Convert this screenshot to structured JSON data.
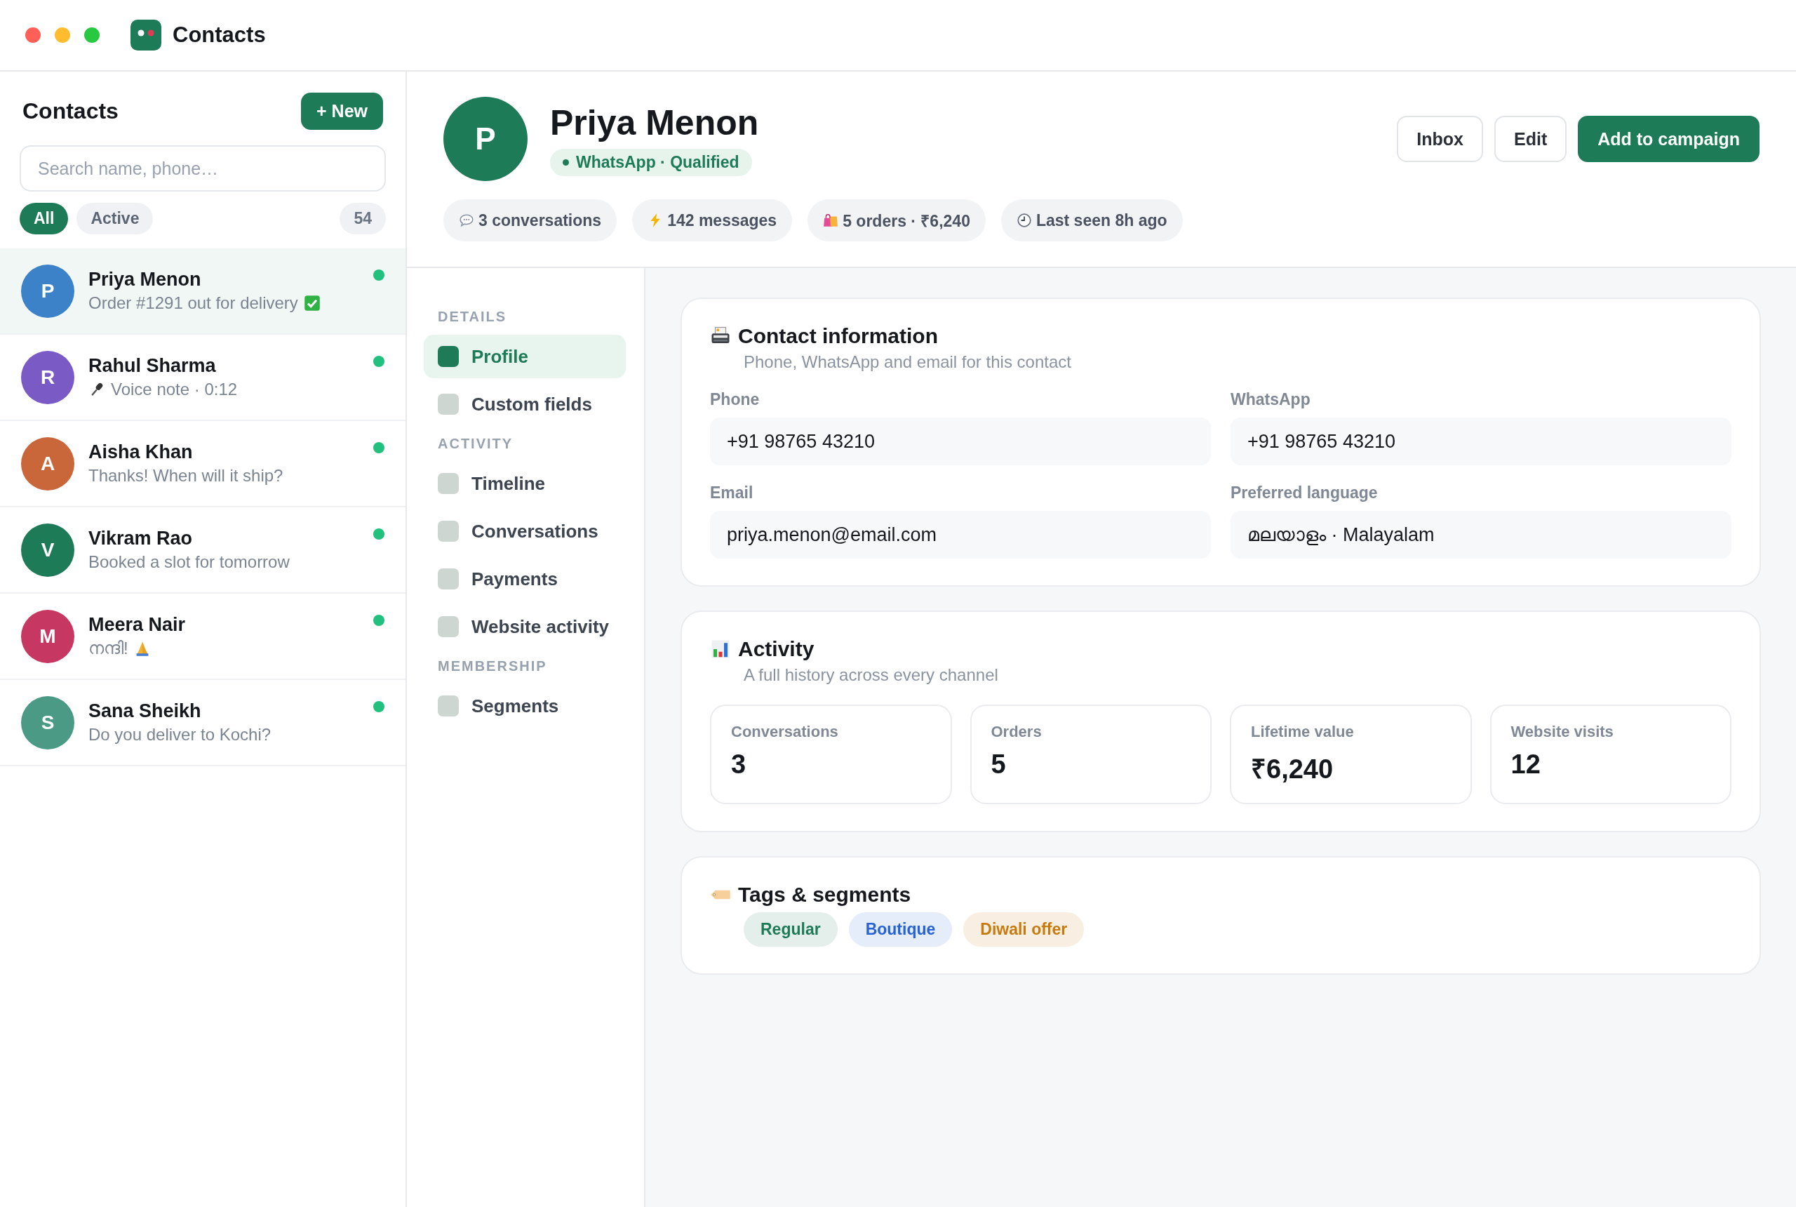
{
  "window": {
    "title": "Contacts"
  },
  "sidebar": {
    "title": "Contacts",
    "new_button": "+ New",
    "search": {
      "placeholder": "Search name, phone…"
    },
    "filters": [
      {
        "label": "All",
        "selected": true
      },
      {
        "label": "Active",
        "selected": false
      }
    ],
    "count": "54",
    "contacts": [
      {
        "initial": "P",
        "name": "Priya Menon",
        "preview": "Order #1291 out for delivery",
        "kind": "check",
        "color": "#3b82c8",
        "online": true,
        "selected": true
      },
      {
        "initial": "R",
        "name": "Rahul Sharma",
        "preview": "Voice note · 0:12",
        "kind": "mic",
        "color": "#7a5bc6",
        "online": true,
        "selected": false
      },
      {
        "initial": "A",
        "name": "Aisha Khan",
        "preview": "Thanks! When will it ship?",
        "color": "#c9673a",
        "online": true,
        "selected": false
      },
      {
        "initial": "V",
        "name": "Vikram Rao",
        "preview": "Booked a slot for tomorrow",
        "color": "#1e7b57",
        "online": true,
        "selected": false
      },
      {
        "initial": "M",
        "name": "Meera Nair",
        "preview": "നന്ദി!",
        "kind": "hands",
        "color": "#c63762",
        "online": true,
        "selected": false
      },
      {
        "initial": "S",
        "name": "Sana Sheikh",
        "preview": "Do you deliver to Kochi?",
        "color": "#4a9a86",
        "online": true,
        "selected": false
      }
    ]
  },
  "profile": {
    "initial": "P",
    "name": "Priya Menon",
    "status": "WhatsApp · Qualified",
    "actions": [
      {
        "label": "Inbox",
        "kind": "secondary"
      },
      {
        "label": "Edit",
        "kind": "secondary"
      },
      {
        "label": "Add to campaign",
        "kind": "primary"
      }
    ],
    "stats": [
      {
        "kind": "speech",
        "label": "3 conversations"
      },
      {
        "kind": "bolt",
        "label": "142 messages"
      },
      {
        "kind": "bags",
        "label": "5 orders · ₹6,240"
      },
      {
        "kind": "clock",
        "label": "Last seen 8h ago"
      }
    ]
  },
  "nav": [
    {
      "title": "DETAILS",
      "items": [
        {
          "label": "Profile",
          "selected": true
        },
        {
          "label": "Custom fields",
          "selected": false
        }
      ]
    },
    {
      "title": "ACTIVITY",
      "items": [
        {
          "label": "Timeline",
          "selected": false
        },
        {
          "label": "Conversations",
          "selected": false
        },
        {
          "label": "Payments",
          "selected": false
        },
        {
          "label": "Website activity",
          "selected": false
        }
      ]
    },
    {
      "title": "MEMBERSHIP",
      "items": [
        {
          "label": "Segments",
          "selected": false
        }
      ]
    }
  ],
  "contact_information": {
    "title": "Contact information",
    "subtitle": "Phone, WhatsApp and email for this contact",
    "fields": [
      {
        "label": "Phone",
        "value": "+91 98765 43210"
      },
      {
        "label": "WhatsApp",
        "value": "+91 98765 43210"
      },
      {
        "label": "Email",
        "value": "priya.menon@email.com"
      },
      {
        "label": "Preferred language",
        "value": "മലയാളം · Malayalam"
      }
    ]
  },
  "activity": {
    "title": "Activity",
    "subtitle": "A full history across every channel",
    "metrics": [
      {
        "label": "Conversations",
        "value": "3"
      },
      {
        "label": "Orders",
        "value": "5"
      },
      {
        "label": "Lifetime value",
        "value": "₹6,240"
      },
      {
        "label": "Website visits",
        "value": "12"
      }
    ]
  },
  "tags": {
    "title": "Tags & segments",
    "items": [
      {
        "label": "Regular",
        "color": "#1e7b57"
      },
      {
        "label": "Boutique",
        "color": "#2563d6"
      },
      {
        "label": "Diwali offer",
        "color": "#c77a0e"
      }
    ]
  }
}
